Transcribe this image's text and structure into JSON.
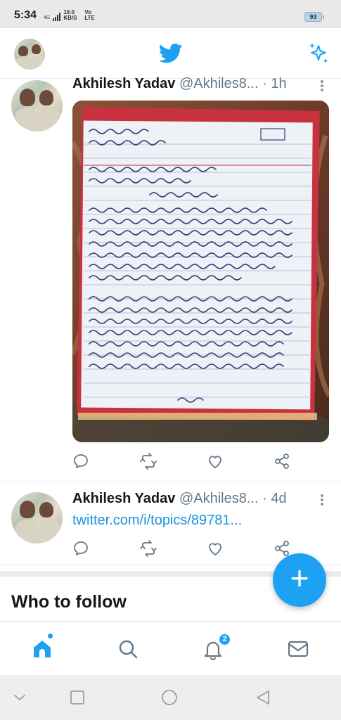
{
  "status_bar": {
    "time": "5:34",
    "network_gen": "4G",
    "net_speed": "19.0 KB/S",
    "carrier": "Vo LTE",
    "battery": "93"
  },
  "app": {
    "name": "Twitter",
    "accent_color": "#1da1f2",
    "icons": [
      "twitter-bird-icon",
      "sparkle-icon"
    ]
  },
  "tweets": [
    {
      "name": "Akhilesh Yadav",
      "handle": "@Akhiles8...",
      "separator": "·",
      "time": "1h",
      "media": "photo-handwritten-essay"
    },
    {
      "name": "Akhilesh Yadav",
      "handle": "@Akhiles8...",
      "separator": "·",
      "time": "4d",
      "link": "twitter.com/i/topics/89781..."
    }
  ],
  "tweet_actions": [
    "reply-icon",
    "retweet-icon",
    "like-icon",
    "share-icon"
  ],
  "who_to_follow": {
    "title": "Who to follow"
  },
  "compose_button": {
    "label": "+"
  },
  "tab_bar": {
    "tabs": [
      "home-icon",
      "search-icon",
      "notifications-icon",
      "messages-icon"
    ],
    "notification_badge": "2"
  },
  "system_nav": [
    "back-icon",
    "recents-icon",
    "home-circle-icon",
    "back-triangle-icon"
  ]
}
